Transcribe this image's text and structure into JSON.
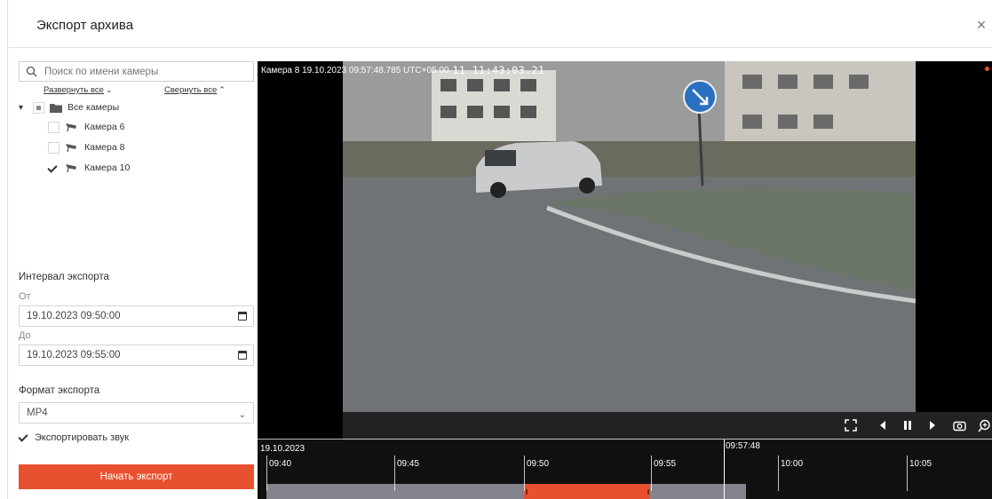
{
  "dialog": {
    "title": "Экспорт архива",
    "close_glyph": "×"
  },
  "search": {
    "placeholder": "Поиск по имени камеры",
    "icon": "search-icon"
  },
  "tree": {
    "expand_all": "Развернуть все",
    "collapse_all": "Свернуть все",
    "root": {
      "label": "Все камеры",
      "state": "partial",
      "icon": "folder-icon"
    },
    "cameras": [
      {
        "label": "Камера 6",
        "checked": false,
        "icon": "camera-icon"
      },
      {
        "label": "Камера 8",
        "checked": false,
        "icon": "camera-icon"
      },
      {
        "label": "Камера 10",
        "checked": true,
        "icon": "camera-icon"
      }
    ]
  },
  "export": {
    "interval_label": "Интервал экспорта",
    "from_label": "От",
    "from_value": "19.10.2023 09:50:00",
    "to_label": "До",
    "to_value": "19.10.2023 09:55:00",
    "format_label": "Формат экспорта",
    "format_value": "MP4",
    "audio_label": "Экспортировать звук",
    "audio_checked": true,
    "start_button": "Начать экспорт"
  },
  "video": {
    "osd_caption": "Камера 8 19.10.2023 09:57:48.785 UTC+05:00",
    "osd_timestamp": "11  11:43:03.21",
    "recording": true,
    "controls": [
      "fullscreen-icon",
      "step-back-icon",
      "pause-icon",
      "play-icon",
      "snapshot-icon",
      "zoom-in-icon"
    ]
  },
  "timeline": {
    "date": "19.10.2023",
    "cursor_time": "09:57:48",
    "ticks": [
      "09:40",
      "09:45",
      "09:50",
      "09:55",
      "10:00",
      "10:05"
    ]
  },
  "colors": {
    "accent": "#e85130",
    "timeline_track": "#aaaab4"
  }
}
